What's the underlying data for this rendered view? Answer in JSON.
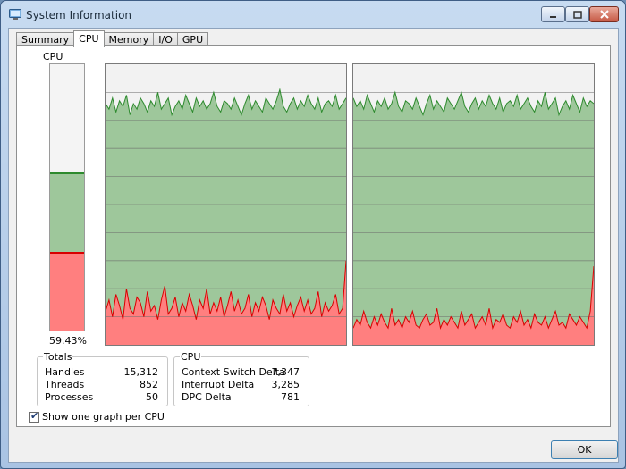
{
  "window": {
    "title": "System Information"
  },
  "tabs": [
    {
      "label": "Summary",
      "active": false
    },
    {
      "label": "CPU",
      "active": true
    },
    {
      "label": "Memory",
      "active": false
    },
    {
      "label": "I/O",
      "active": false
    },
    {
      "label": "GPU",
      "active": false
    }
  ],
  "cpu": {
    "label": "CPU",
    "usage_percent": 59.43,
    "usage_text": "59.43%",
    "kernel_percent": 29.5
  },
  "totals": {
    "title": "Totals",
    "rows": [
      {
        "key": "Handles",
        "value": "15,312"
      },
      {
        "key": "Threads",
        "value": "852"
      },
      {
        "key": "Processes",
        "value": "50"
      }
    ]
  },
  "cpu_stats": {
    "title": "CPU",
    "rows": [
      {
        "key": "Context Switch Delta",
        "value": "7,347"
      },
      {
        "key": "Interrupt Delta",
        "value": "3,285"
      },
      {
        "key": "DPC Delta",
        "value": "781"
      }
    ]
  },
  "options": {
    "one_graph_per_cpu_label": "Show one graph per CPU",
    "one_graph_per_cpu_checked": true
  },
  "buttons": {
    "ok": "OK"
  },
  "colors": {
    "total_line": "#2d8a2d",
    "total_fill": "#9ec79b",
    "kernel_line": "#d80000",
    "kernel_fill": "#ff7f7f",
    "graph_bg": "#f2f2f2",
    "grid": "#6e6e6e"
  },
  "chart_data": {
    "type": "area",
    "ylim": [
      0,
      100
    ],
    "series_per_cpu": [
      {
        "total": [
          86,
          84,
          88,
          83,
          87,
          85,
          89,
          82,
          86,
          84,
          88,
          86,
          83,
          87,
          85,
          90,
          84,
          86,
          88,
          82,
          85,
          87,
          84,
          89,
          86,
          83,
          88,
          85,
          87,
          84,
          86,
          90,
          85,
          83,
          87,
          86,
          84,
          88,
          85,
          82,
          86,
          89,
          84,
          87,
          85,
          83,
          88,
          86,
          84,
          87,
          91,
          85,
          83,
          86,
          88,
          84,
          87,
          85,
          89,
          86,
          84,
          88,
          83,
          86,
          87,
          85,
          89,
          84,
          86,
          88
        ],
        "kernel": [
          12,
          16,
          10,
          18,
          14,
          9,
          20,
          13,
          11,
          17,
          15,
          10,
          19,
          12,
          14,
          9,
          16,
          21,
          11,
          13,
          17,
          10,
          15,
          12,
          18,
          14,
          9,
          16,
          13,
          20,
          11,
          15,
          12,
          17,
          10,
          14,
          19,
          12,
          16,
          11,
          13,
          18,
          10,
          15,
          12,
          17,
          14,
          9,
          16,
          13,
          11,
          18,
          12,
          15,
          10,
          14,
          17,
          12,
          16,
          11,
          13,
          19,
          10,
          15,
          12,
          14,
          18,
          11,
          13,
          30
        ]
      },
      {
        "total": [
          88,
          85,
          87,
          84,
          89,
          86,
          83,
          87,
          85,
          88,
          84,
          86,
          90,
          85,
          83,
          87,
          86,
          84,
          88,
          85,
          82,
          86,
          89,
          84,
          87,
          85,
          83,
          88,
          86,
          84,
          87,
          90,
          85,
          83,
          86,
          88,
          84,
          87,
          85,
          89,
          86,
          84,
          88,
          83,
          86,
          87,
          85,
          89,
          84,
          86,
          88,
          85,
          83,
          87,
          85,
          90,
          84,
          86,
          88,
          82,
          85,
          87,
          84,
          89,
          86,
          83,
          88,
          85,
          87,
          86
        ],
        "kernel": [
          6,
          9,
          7,
          12,
          8,
          6,
          10,
          7,
          11,
          8,
          6,
          13,
          7,
          9,
          6,
          10,
          8,
          12,
          7,
          6,
          9,
          11,
          7,
          8,
          13,
          6,
          9,
          7,
          10,
          8,
          6,
          12,
          7,
          9,
          11,
          6,
          8,
          10,
          7,
          13,
          6,
          9,
          8,
          11,
          7,
          6,
          10,
          8,
          12,
          7,
          9,
          6,
          11,
          8,
          7,
          10,
          6,
          9,
          12,
          7,
          8,
          6,
          11,
          9,
          7,
          10,
          8,
          6,
          12,
          28
        ]
      }
    ]
  }
}
